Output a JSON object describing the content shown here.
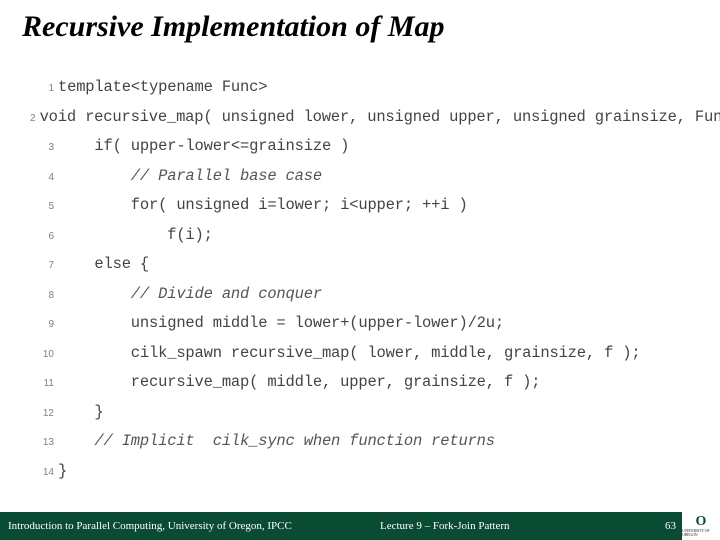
{
  "title": "Recursive Implementation of Map",
  "code": {
    "lines": [
      {
        "n": "1",
        "indent": 0,
        "text": "template<typename Func>",
        "comment": false
      },
      {
        "n": "2",
        "indent": 0,
        "text": "void recursive_map( unsigned lower, unsigned upper, unsigned grainsize, Func f ) {",
        "comment": false
      },
      {
        "n": "3",
        "indent": 1,
        "text": "if( upper-lower<=grainsize )",
        "comment": false
      },
      {
        "n": "4",
        "indent": 2,
        "text": "// Parallel base case",
        "comment": true
      },
      {
        "n": "5",
        "indent": 2,
        "text": "for( unsigned i=lower; i<upper; ++i )",
        "comment": false
      },
      {
        "n": "6",
        "indent": 3,
        "text": "f(i);",
        "comment": false
      },
      {
        "n": "7",
        "indent": 1,
        "text": "else {",
        "comment": false
      },
      {
        "n": "8",
        "indent": 2,
        "text": "// Divide and conquer",
        "comment": true
      },
      {
        "n": "9",
        "indent": 2,
        "text": "unsigned middle = lower+(upper-lower)/2u;",
        "comment": false
      },
      {
        "n": "10",
        "indent": 2,
        "text": "cilk_spawn recursive_map( lower, middle, grainsize, f );",
        "comment": false
      },
      {
        "n": "11",
        "indent": 2,
        "text": "recursive_map( middle, upper, grainsize, f );",
        "comment": false
      },
      {
        "n": "12",
        "indent": 1,
        "text": "}",
        "comment": false
      },
      {
        "n": "13",
        "indent": 1,
        "text": "// Implicit  cilk_sync when function returns",
        "comment": true
      },
      {
        "n": "14",
        "indent": 0,
        "text": "}",
        "comment": false
      }
    ]
  },
  "footer": {
    "left": "Introduction to Parallel Computing, University of Oregon, IPCC",
    "mid": "Lecture 9 – Fork-Join Pattern",
    "page": "63",
    "logo_letter": "O",
    "logo_sub": "UNIVERSITY OF OREGON"
  },
  "colors": {
    "footer_bg": "#0a4b33"
  }
}
